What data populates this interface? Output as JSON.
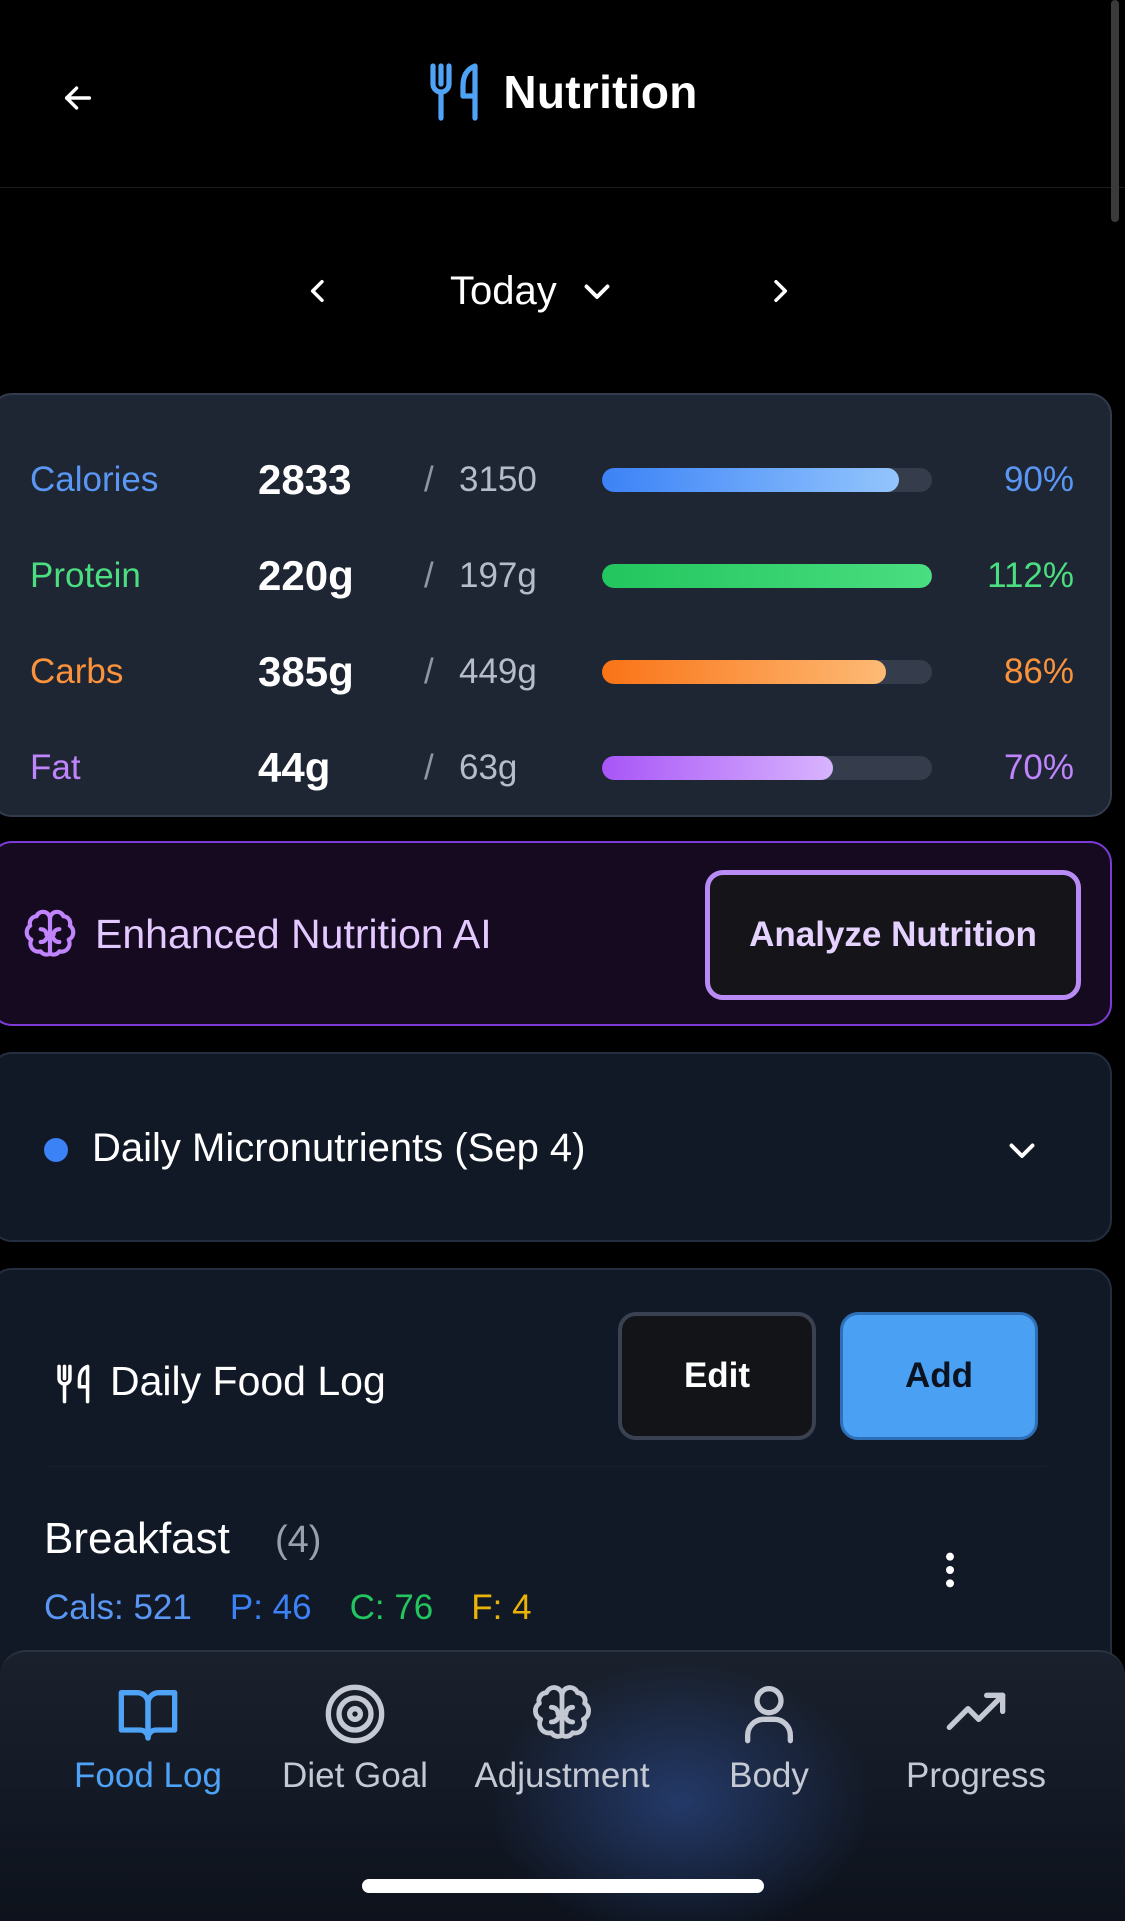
{
  "header": {
    "title": "Nutrition",
    "title_icon": "utensils-icon",
    "back_icon": "arrow-left-icon"
  },
  "date_nav": {
    "label": "Today",
    "prev_icon": "chevron-left-icon",
    "next_icon": "chevron-right-icon",
    "dropdown_icon": "chevron-down-icon"
  },
  "macros": [
    {
      "name": "Calories",
      "value": "2833",
      "goal": "3150",
      "percent_label": "90%",
      "progress": 0.9,
      "color": "#5a97f4"
    },
    {
      "name": "Protein",
      "value": "220g",
      "goal": "197g",
      "percent_label": "112%",
      "progress": 1.0,
      "color": "#4ade80"
    },
    {
      "name": "Carbs",
      "value": "385g",
      "goal": "449g",
      "percent_label": "86%",
      "progress": 0.86,
      "color": "#fb923c"
    },
    {
      "name": "Fat",
      "value": "44g",
      "goal": "63g",
      "percent_label": "70%",
      "progress": 0.7,
      "color": "#c084fc"
    }
  ],
  "macro_separator": "/",
  "ai": {
    "title": "Enhanced Nutrition AI",
    "button_label": "Analyze Nutrition",
    "icon": "brain-icon"
  },
  "micronutrients": {
    "title": "Daily Micronutrients (Sep 4)",
    "icon": "chevron-down-icon"
  },
  "food_log": {
    "title": "Daily Food Log",
    "edit_label": "Edit",
    "add_label": "Add",
    "meals": [
      {
        "name": "Breakfast",
        "count": "(4)",
        "cals": "Cals: 521",
        "protein": "P: 46",
        "carbs": "C: 76",
        "fat": "F: 4"
      }
    ]
  },
  "bottom_nav": [
    {
      "label": "Food Log",
      "icon": "book-open-icon",
      "active": true
    },
    {
      "label": "Diet Goal",
      "icon": "target-icon",
      "active": false
    },
    {
      "label": "Adjustment",
      "icon": "brain-icon",
      "active": false
    },
    {
      "label": "Body",
      "icon": "user-icon",
      "active": false
    },
    {
      "label": "Progress",
      "icon": "trending-up-icon",
      "active": false
    }
  ],
  "colors": {
    "accent_blue": "#4aa0f2",
    "ai_purple": "#7c3bd6",
    "meal_cals": "#5a97f4",
    "meal_protein": "#3b82f6",
    "meal_carbs": "#22c55e",
    "meal_fat": "#eab308"
  }
}
